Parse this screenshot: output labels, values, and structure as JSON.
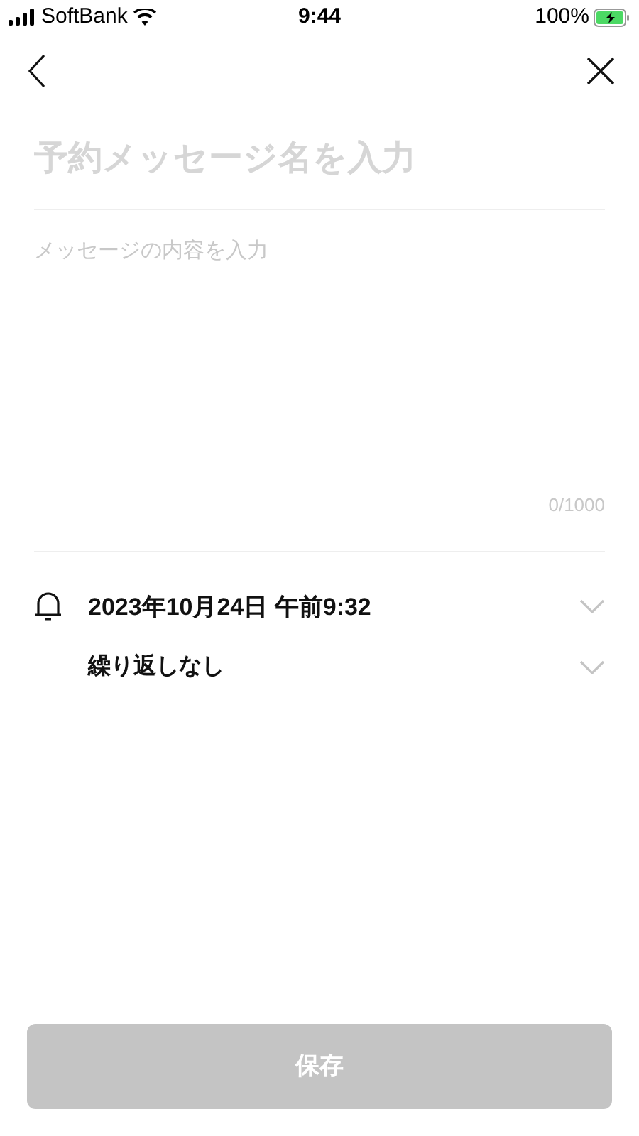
{
  "status_bar": {
    "carrier": "SoftBank",
    "time": "9:44",
    "battery": "100%",
    "charging": true
  },
  "title_field": {
    "placeholder": "予約メッセージ名を入力"
  },
  "message_field": {
    "placeholder": "メッセージの内容を入力",
    "counter": "0/1000"
  },
  "reminder": {
    "date": "2023年10月24日 午前9:32",
    "repeat": "繰り返しなし"
  },
  "save_button": {
    "label": "保存",
    "disabled": true
  }
}
